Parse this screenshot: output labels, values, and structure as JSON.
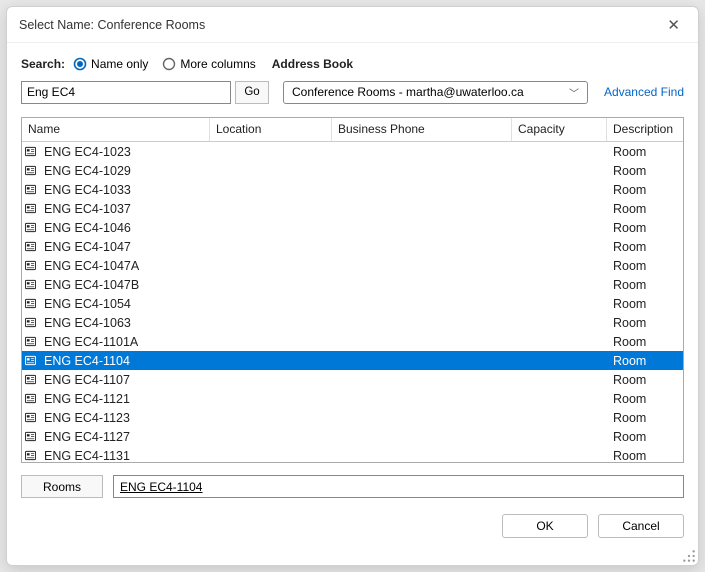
{
  "title": "Select Name: Conference Rooms",
  "search_label": "Search:",
  "radios": {
    "name_only": "Name only",
    "more_columns": "More columns",
    "selected": "name_only"
  },
  "address_book_label": "Address Book",
  "search_value": "Eng EC4",
  "go_label": "Go",
  "address_book_value": "Conference Rooms - martha@uwaterloo.ca",
  "advanced_find": "Advanced Find",
  "columns": {
    "name": "Name",
    "location": "Location",
    "business_phone": "Business Phone",
    "capacity": "Capacity",
    "description": "Description"
  },
  "rows": [
    {
      "name": "ENG EC4-1023",
      "location": "",
      "business_phone": "",
      "capacity": "",
      "description": "Room",
      "selected": false
    },
    {
      "name": "ENG EC4-1029",
      "location": "",
      "business_phone": "",
      "capacity": "",
      "description": "Room",
      "selected": false
    },
    {
      "name": "ENG EC4-1033",
      "location": "",
      "business_phone": "",
      "capacity": "",
      "description": "Room",
      "selected": false
    },
    {
      "name": "ENG EC4-1037",
      "location": "",
      "business_phone": "",
      "capacity": "",
      "description": "Room",
      "selected": false
    },
    {
      "name": "ENG EC4-1046",
      "location": "",
      "business_phone": "",
      "capacity": "",
      "description": "Room",
      "selected": false
    },
    {
      "name": "ENG EC4-1047",
      "location": "",
      "business_phone": "",
      "capacity": "",
      "description": "Room",
      "selected": false
    },
    {
      "name": "ENG EC4-1047A",
      "location": "",
      "business_phone": "",
      "capacity": "",
      "description": "Room",
      "selected": false
    },
    {
      "name": "ENG EC4-1047B",
      "location": "",
      "business_phone": "",
      "capacity": "",
      "description": "Room",
      "selected": false
    },
    {
      "name": "ENG EC4-1054",
      "location": "",
      "business_phone": "",
      "capacity": "",
      "description": "Room",
      "selected": false
    },
    {
      "name": "ENG EC4-1063",
      "location": "",
      "business_phone": "",
      "capacity": "",
      "description": "Room",
      "selected": false
    },
    {
      "name": "ENG EC4-1101A",
      "location": "",
      "business_phone": "",
      "capacity": "",
      "description": "Room",
      "selected": false
    },
    {
      "name": "ENG EC4-1104",
      "location": "",
      "business_phone": "",
      "capacity": "",
      "description": "Room",
      "selected": true
    },
    {
      "name": "ENG EC4-1107",
      "location": "",
      "business_phone": "",
      "capacity": "",
      "description": "Room",
      "selected": false
    },
    {
      "name": "ENG EC4-1121",
      "location": "",
      "business_phone": "",
      "capacity": "",
      "description": "Room",
      "selected": false
    },
    {
      "name": "ENG EC4-1123",
      "location": "",
      "business_phone": "",
      "capacity": "",
      "description": "Room",
      "selected": false
    },
    {
      "name": "ENG EC4-1127",
      "location": "",
      "business_phone": "",
      "capacity": "",
      "description": "Room",
      "selected": false
    },
    {
      "name": "ENG EC4-1131",
      "location": "",
      "business_phone": "",
      "capacity": "",
      "description": "Room",
      "selected": false
    }
  ],
  "rooms_button": "Rooms",
  "selected_value": "ENG EC4-1104",
  "ok_label": "OK",
  "cancel_label": "Cancel"
}
